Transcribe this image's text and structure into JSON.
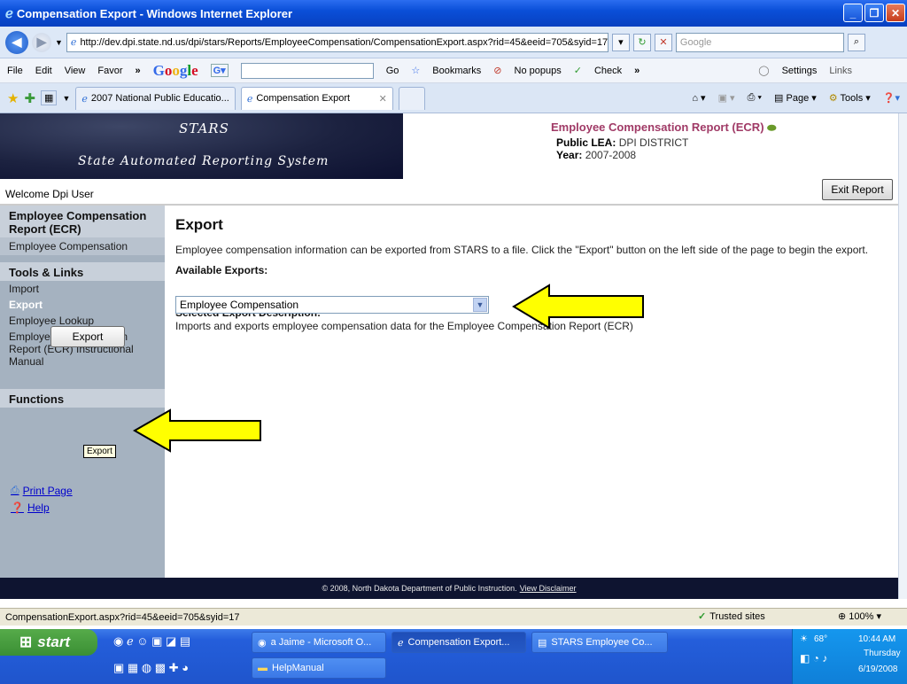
{
  "browser": {
    "title": "Compensation Export - Windows Internet Explorer",
    "url": "http://dev.dpi.state.nd.us/dpi/stars/Reports/EmployeeCompensation/CompensationExport.aspx?rid=45&eeid=705&syid=17",
    "search_placeholder": "Google",
    "menu": [
      "File",
      "Edit",
      "View",
      "Favor"
    ],
    "google_go": "Go",
    "bookmarks": "Bookmarks",
    "no_popups": "No popups",
    "check": "Check",
    "settings": "Settings",
    "links": "Links",
    "tabs": [
      {
        "label": "2007 National Public Educatio..."
      },
      {
        "label": "Compensation Export"
      }
    ],
    "cmd_page": "Page",
    "cmd_tools": "Tools"
  },
  "header": {
    "app_title": "STARS",
    "app_subtitle": "State Automated Reporting System",
    "welcome": "Welcome Dpi User",
    "report_title": "Employee Compensation Report (ECR)",
    "lea_label": "Public LEA:",
    "lea_value": "DPI DISTRICT",
    "year_label": "Year:",
    "year_value": "2007-2008",
    "exit_button": "Exit Report"
  },
  "sidebar": {
    "section1_title": "Employee Compensation Report (ECR)",
    "section1_item": "Employee Compensation",
    "tools_title": "Tools & Links",
    "tools_items": [
      "Import",
      "Export",
      "Employee Lookup",
      "Employee Compensation Report (ECR) Instructional Manual"
    ],
    "functions_title": "Functions",
    "export_button": "Export",
    "export_tooltip": "Export",
    "print_link": "Print Page",
    "help_link": "Help"
  },
  "main": {
    "heading": "Export",
    "intro": "Employee compensation information can be exported from STARS to a file. Click the \"Export\" button on the left side of the page to begin the export.",
    "available_label": "Available Exports:",
    "selected_export": "Employee Compensation",
    "desc_label": "Selected Export Description:",
    "desc_text": "Imports and exports employee compensation data for the Employee Compensation Report (ECR)"
  },
  "footer": {
    "copyright": "© 2008, North Dakota Department of Public Instruction.",
    "disclaimer_link": "View Disclaimer"
  },
  "statusbar": {
    "url": "CompensationExport.aspx?rid=45&eeid=705&syid=17",
    "zone": "Trusted sites",
    "zoom": "100%"
  },
  "taskbar": {
    "start": "start",
    "buttons": [
      "a Jaime - Microsoft O...",
      "Compensation Export...",
      "STARS Employee Co...",
      "HelpManual"
    ],
    "temperature": "68°",
    "time": "10:44 AM",
    "day": "Thursday",
    "date": "6/19/2008"
  },
  "colors": {
    "report_title": "#a03a66",
    "sidebar_bg": "#a5b2c0",
    "banner_bg": "#1c2240",
    "arrow_fill": "#ffff00"
  }
}
